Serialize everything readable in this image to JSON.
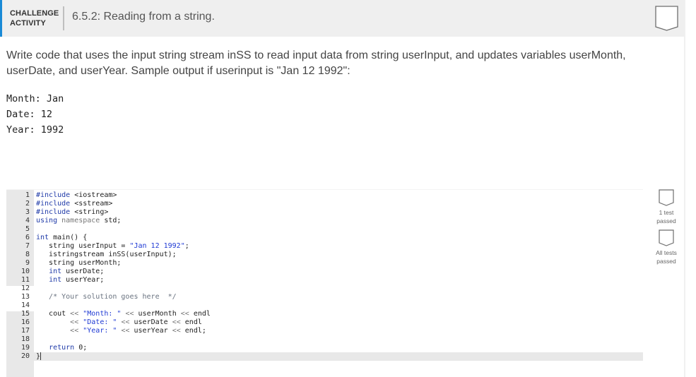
{
  "header": {
    "label_line1": "CHALLENGE",
    "label_line2": "ACTIVITY",
    "title": "6.5.2: Reading from a string.",
    "badge_icon": "completion-badge-icon"
  },
  "prompt": {
    "text": "Write code that uses the input string stream inSS to read input data from string userInput, and updates variables userMonth, userDate, and userYear. Sample output if userinput is \"Jan 12 1992\":"
  },
  "sample_output": [
    "Month: Jan",
    "Date: 12",
    "Year: 1992"
  ],
  "editor": {
    "line_numbers": [
      "1",
      "2",
      "3",
      "4",
      "5",
      "6",
      "7",
      "8",
      "9",
      "10",
      "11",
      "12",
      "13",
      "14",
      "15",
      "16",
      "17",
      "18",
      "19",
      "20"
    ],
    "lines": [
      "#include <iostream>",
      "#include <sstream>",
      "#include <string>",
      "using namespace std;",
      "",
      "int main() {",
      "   string userInput = \"Jan 12 1992\";",
      "   istringstream inSS(userInput);",
      "   string userMonth;",
      "   int userDate;",
      "   int userYear;",
      "",
      "   /* Your solution goes here  */",
      "",
      "   cout << \"Month: \" << userMonth << endl",
      "        << \"Date: \" << userDate << endl",
      "        << \"Year: \" << userYear << endl;",
      "",
      "   return 0;",
      "}"
    ]
  },
  "tests": [
    {
      "label": "1 test passed",
      "icon": "test-badge-icon"
    },
    {
      "label": "All tests passed",
      "icon": "test-badge-icon"
    }
  ]
}
